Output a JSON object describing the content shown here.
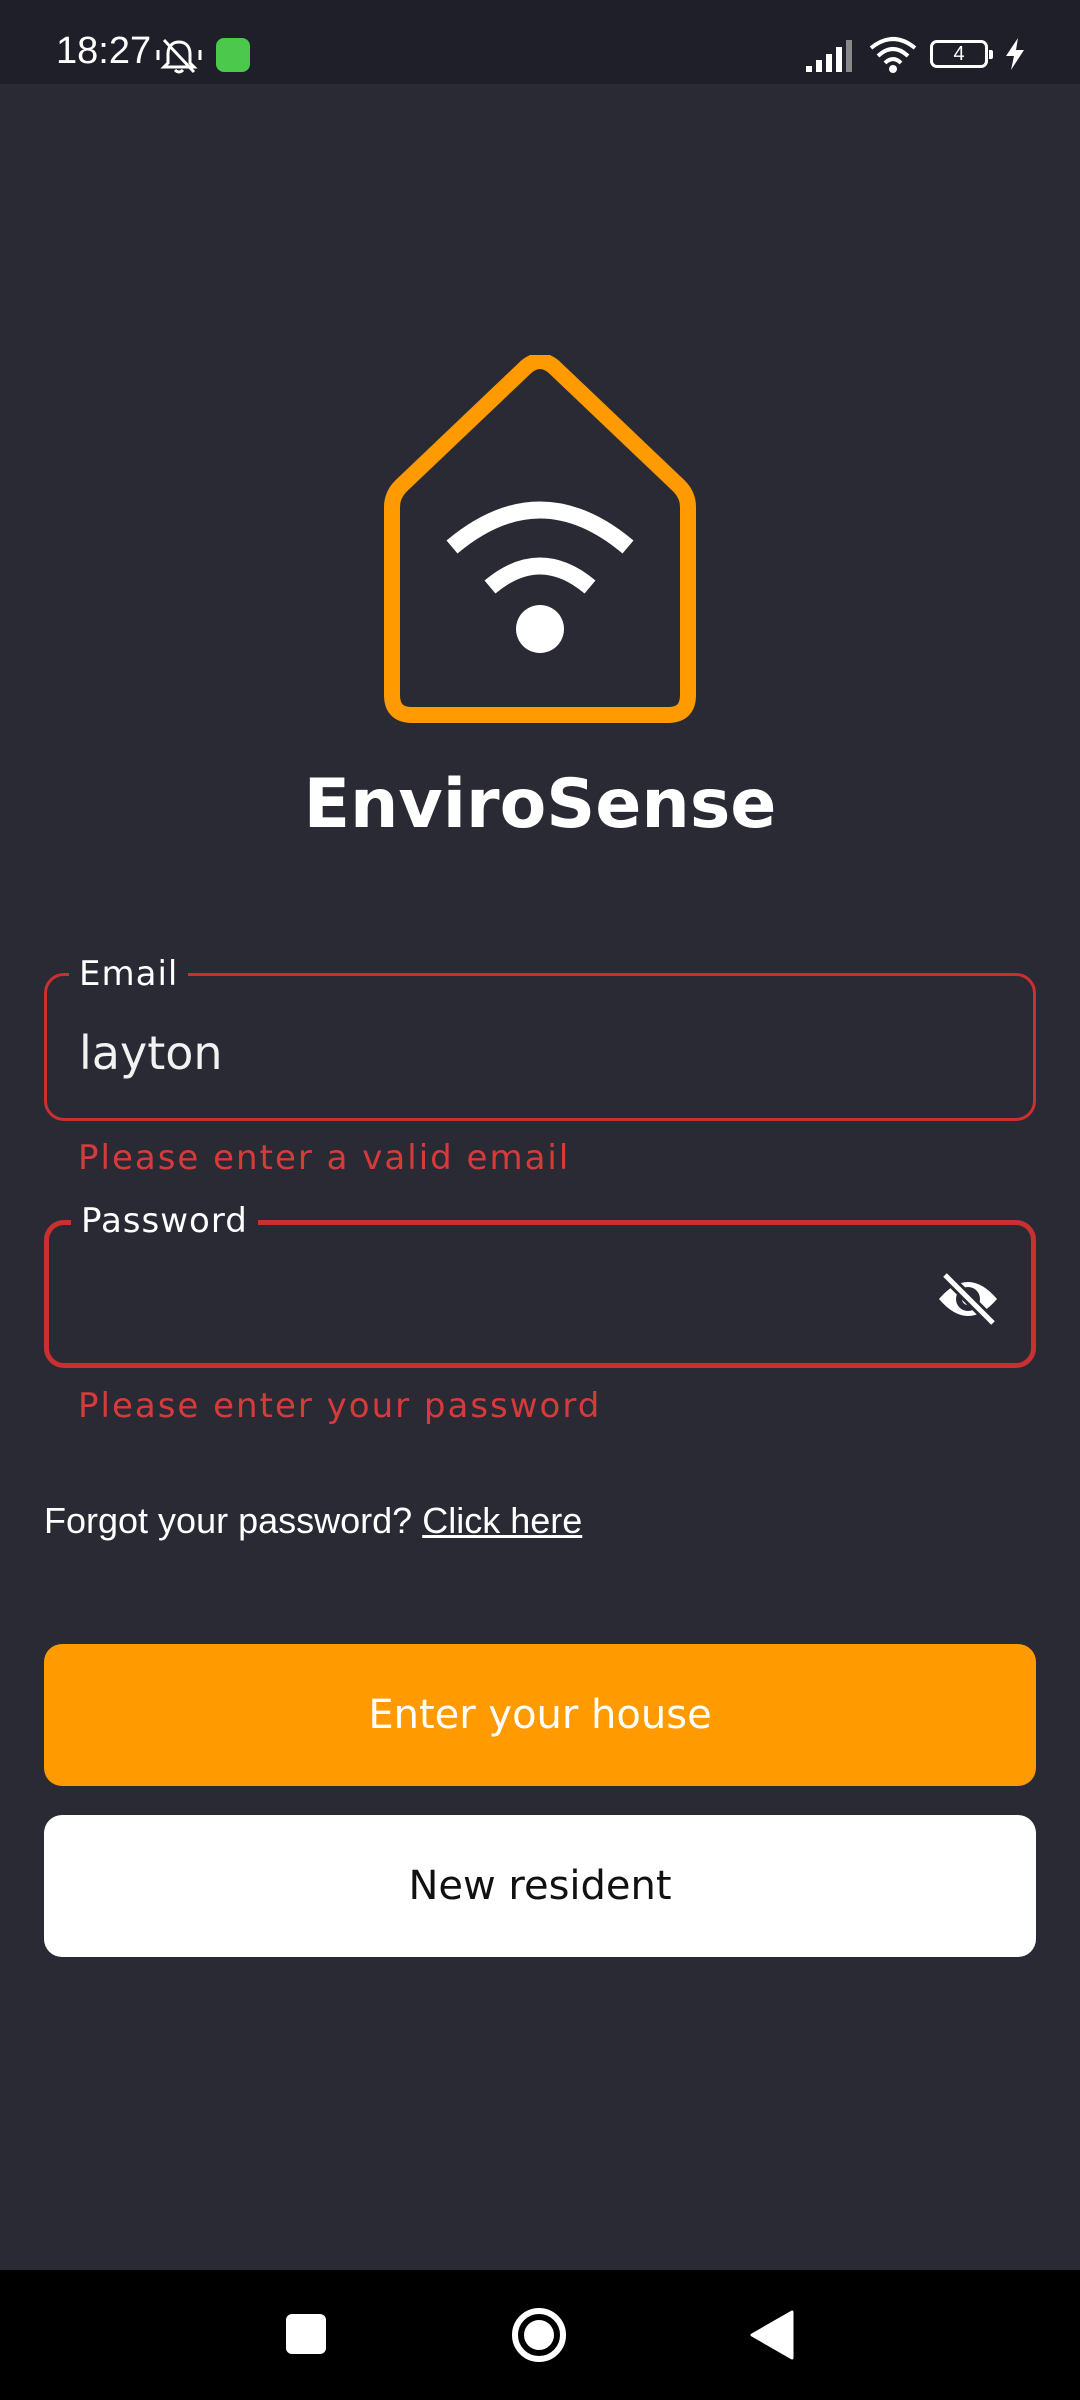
{
  "status_bar": {
    "time": "18:27",
    "icons": [
      "mute-bell-icon",
      "app-notification-icon",
      "signal-icon",
      "wifi-icon",
      "battery-icon",
      "charging-icon"
    ],
    "battery_level": "4"
  },
  "app": {
    "name": "EnviroSense",
    "logo": "house-wifi-icon",
    "accent_color": "#FF9A00",
    "error_color": "#D63B3A"
  },
  "login": {
    "email": {
      "label": "Email",
      "value": "layton",
      "error": "Please enter a valid email"
    },
    "password": {
      "label": "Password",
      "value": "",
      "error": "Please enter your password",
      "toggle_icon": "eye-off-icon"
    },
    "forgot_text": "Forgot your password?",
    "forgot_link": "Click here",
    "primary_button": "Enter your house",
    "secondary_button": "New resident"
  },
  "nav_bar": {
    "icons": [
      "recents-icon",
      "home-icon",
      "back-icon"
    ]
  }
}
